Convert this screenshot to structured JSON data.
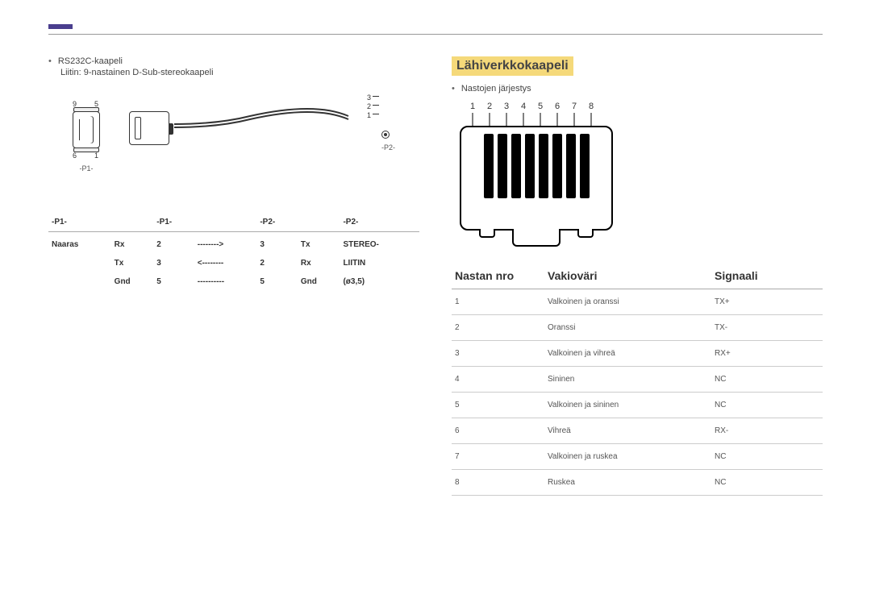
{
  "left": {
    "bullet": "RS232C-kaapeli",
    "subline": "Liitin: 9-nastainen D-Sub-stereokaapeli",
    "diagram": {
      "pin9": "9",
      "pin5": "5",
      "pin6": "6",
      "pin1": "1",
      "p1label": "-P1-",
      "p2label": "-P2-",
      "j3": "3",
      "j2": "2",
      "j1": "1"
    },
    "table": {
      "headers": [
        "-P1-",
        "",
        "-P1-",
        "",
        "-P2-",
        "",
        "-P2-"
      ],
      "rows": [
        [
          "Naaras",
          "Rx",
          "2",
          "-------->",
          "3",
          "Tx",
          "STEREO-"
        ],
        [
          "",
          "Tx",
          "3",
          "<--------",
          "2",
          "Rx",
          "LIITIN"
        ],
        [
          "",
          "Gnd",
          "5",
          "----------",
          "5",
          "Gnd",
          "(ø3,5)"
        ]
      ]
    }
  },
  "right": {
    "sectionTitle": "Lähiverkkokaapeli",
    "bullet": "Nastojen järjestys",
    "pinNumbers": [
      "1",
      "2",
      "3",
      "4",
      "5",
      "6",
      "7",
      "8"
    ],
    "table": {
      "headers": [
        "Nastan nro",
        "Vakioväri",
        "Signaali"
      ],
      "rows": [
        [
          "1",
          "Valkoinen ja oranssi",
          "TX+"
        ],
        [
          "2",
          "Oranssi",
          "TX-"
        ],
        [
          "3",
          "Valkoinen ja vihreä",
          "RX+"
        ],
        [
          "4",
          "Sininen",
          "NC"
        ],
        [
          "5",
          "Valkoinen ja sininen",
          "NC"
        ],
        [
          "6",
          "Vihreä",
          "RX-"
        ],
        [
          "7",
          "Valkoinen ja ruskea",
          "NC"
        ],
        [
          "8",
          "Ruskea",
          "NC"
        ]
      ]
    }
  }
}
